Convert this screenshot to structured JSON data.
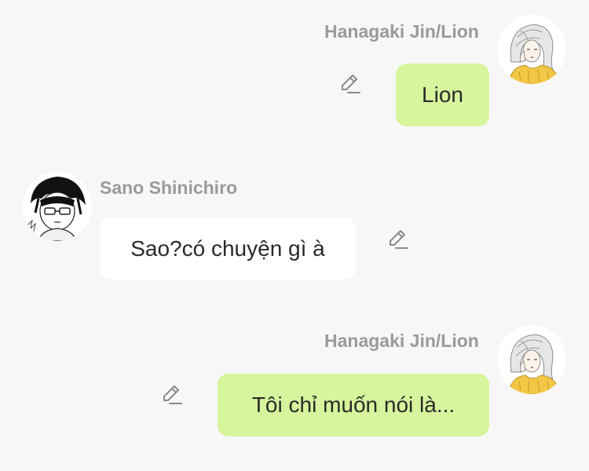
{
  "messages": [
    {
      "sender": "Hanagaki Jin/Lion",
      "text": "Lion",
      "side": "right",
      "avatar": "girl-avatar"
    },
    {
      "sender": "Sano Shinichiro",
      "text": "Sao?có chuyện gì à",
      "side": "left",
      "avatar": "boy-avatar"
    },
    {
      "sender": "Hanagaki Jin/Lion",
      "text": "Tôi chỉ muốn nói là...",
      "side": "right",
      "avatar": "girl-avatar"
    }
  ],
  "colors": {
    "background": "#f7f7f7",
    "sent_bubble": "#d6f59c",
    "received_bubble": "#ffffff",
    "sender_name": "#9a9a9a"
  },
  "icons": {
    "edit": "pencil-edit-icon"
  }
}
